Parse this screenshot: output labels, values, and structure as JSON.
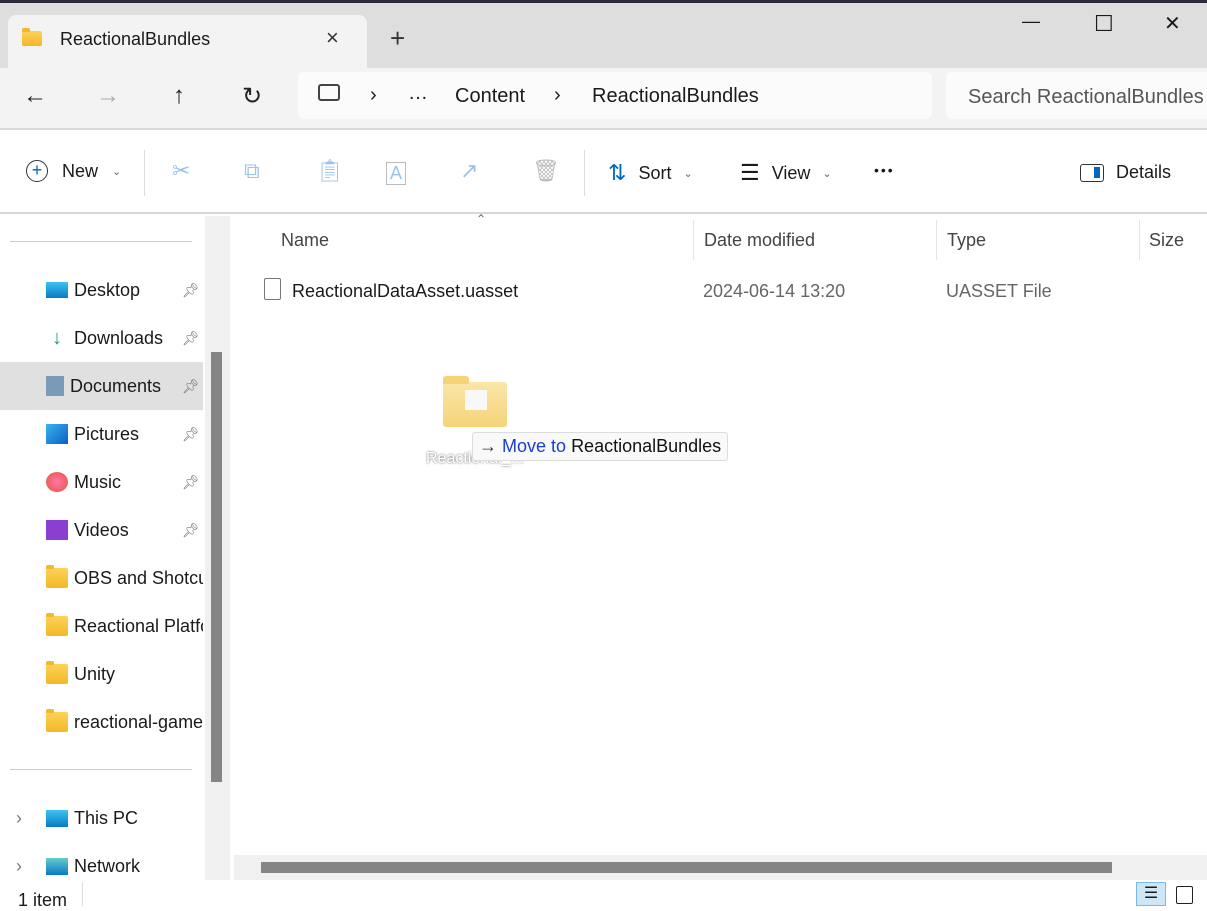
{
  "window": {
    "tab_title": "ReactionalBundles",
    "new_tab": "+",
    "close_tab": "×",
    "minimize": "—",
    "maximize": "☐",
    "close": "✕"
  },
  "nav": {
    "back": "←",
    "forward": "→",
    "up": "↑",
    "refresh": "↻",
    "breadcrumb": [
      "…",
      "Content",
      "ReactionalBundles"
    ],
    "search_placeholder": "Search ReactionalBundles"
  },
  "toolbar": {
    "new_label": "New",
    "sort_label": "Sort",
    "view_label": "View",
    "more": "•••",
    "details_label": "Details"
  },
  "sidebar": {
    "quick_access": [
      {
        "label": "Desktop",
        "icon": "desktop-icon",
        "pinned": true
      },
      {
        "label": "Downloads",
        "icon": "download-icon",
        "pinned": true
      },
      {
        "label": "Documents",
        "icon": "documents-icon",
        "pinned": true,
        "selected": true
      },
      {
        "label": "Pictures",
        "icon": "pictures-icon",
        "pinned": true
      },
      {
        "label": "Music",
        "icon": "music-icon",
        "pinned": true
      },
      {
        "label": "Videos",
        "icon": "videos-icon",
        "pinned": true
      },
      {
        "label": "OBS and Shotcut",
        "icon": "folder-icon"
      },
      {
        "label": "Reactional Platform",
        "icon": "folder-icon"
      },
      {
        "label": "Unity",
        "icon": "folder-icon"
      },
      {
        "label": "reactional-game",
        "icon": "folder-icon"
      }
    ],
    "this_pc": "This PC",
    "network": "Network"
  },
  "columns": {
    "name": "Name",
    "date": "Date modified",
    "type": "Type",
    "size": "Size"
  },
  "files": [
    {
      "name": "ReactionalDataAsset.uasset",
      "date": "2024-06-14 13:20",
      "type": "UASSET File",
      "size": ""
    }
  ],
  "drag": {
    "tooltip_prefix": "Move to",
    "tooltip_target": "ReactionalBundles",
    "ghost_label": "Reactional_..."
  },
  "status": {
    "count": "1 item"
  }
}
